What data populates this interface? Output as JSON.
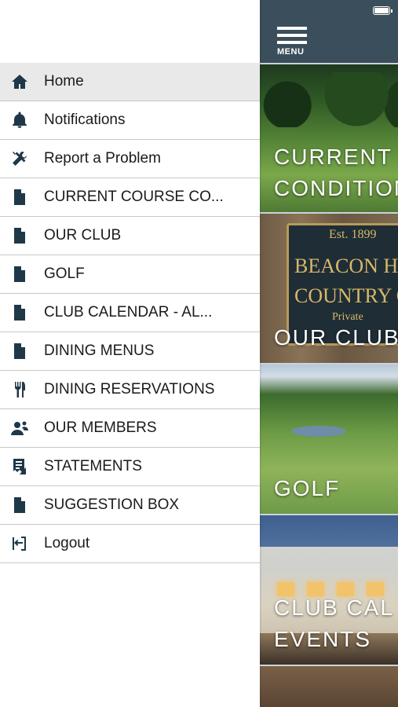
{
  "status_bar": {
    "battery_icon": "battery-icon"
  },
  "app": {
    "menu_label": "MENU",
    "tiles": [
      {
        "line1": "CURRENT",
        "line2": "CONDITIONS"
      },
      {
        "line1": "OUR CLUB",
        "sign_est": "Est. 1899",
        "sign_line1": "BEACON HILL",
        "sign_line2": "COUNTRY CLUB",
        "sign_line3": "Private"
      },
      {
        "line1": "GOLF"
      },
      {
        "line1": "CLUB CAL",
        "line2": "EVENTS"
      }
    ]
  },
  "drawer": {
    "items": [
      {
        "label": "Home",
        "icon": "home-icon",
        "active": true
      },
      {
        "label": "Notifications",
        "icon": "bell-icon"
      },
      {
        "label": "Report a Problem",
        "icon": "tools-icon"
      },
      {
        "label": "CURRENT COURSE CO...",
        "icon": "document-icon"
      },
      {
        "label": "OUR CLUB",
        "icon": "document-icon"
      },
      {
        "label": "GOLF",
        "icon": "document-icon"
      },
      {
        "label": "CLUB CALENDAR - AL...",
        "icon": "document-icon"
      },
      {
        "label": "DINING MENUS",
        "icon": "document-icon"
      },
      {
        "label": "DINING RESERVATIONS",
        "icon": "utensils-icon"
      },
      {
        "label": "OUR MEMBERS",
        "icon": "members-icon"
      },
      {
        "label": "STATEMENTS",
        "icon": "statement-icon"
      },
      {
        "label": "SUGGESTION BOX",
        "icon": "document-icon"
      },
      {
        "label": "Logout",
        "icon": "logout-icon"
      }
    ]
  },
  "colors": {
    "icon": "#1f3847",
    "header": "#3a4e5b",
    "active_row": "#e9e9e9"
  }
}
